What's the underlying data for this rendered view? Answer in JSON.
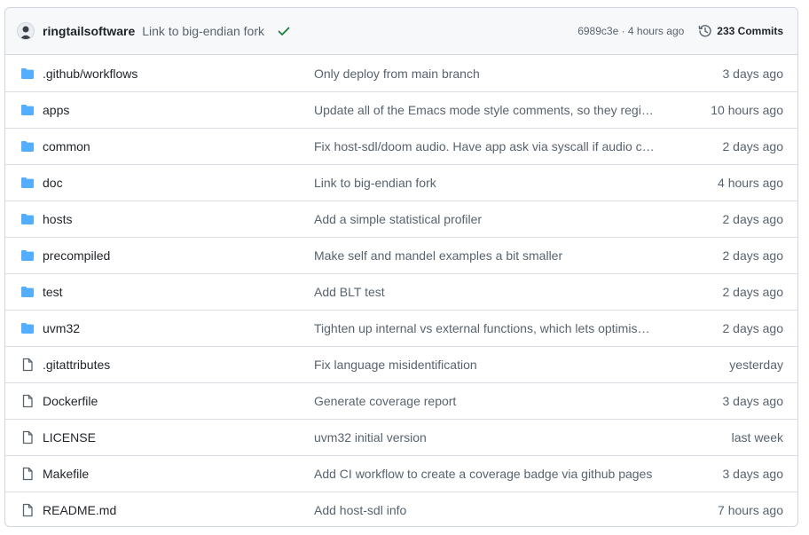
{
  "header": {
    "author": "ringtailsoftware",
    "commit_message": "Link to big-endian fork",
    "commit_hash_time": "6989c3e · 4 hours ago",
    "commits_count": "233 Commits",
    "status_color": "#1a7f37"
  },
  "colors": {
    "folder": "#54aeff",
    "file_icon": "#59636e"
  },
  "files": [
    {
      "type": "folder",
      "name": ".github/workflows",
      "message": "Only deploy from main branch",
      "age": "3 days ago"
    },
    {
      "type": "folder",
      "name": "apps",
      "message": "Update all of the Emacs mode style comments, so they register correctly",
      "age": "10 hours ago"
    },
    {
      "type": "folder",
      "name": "common",
      "message": "Fix host-sdl/doom audio. Have app ask via syscall if audio can be queued",
      "age": "2 days ago"
    },
    {
      "type": "folder",
      "name": "doc",
      "message": "Link to big-endian fork",
      "age": "4 hours ago"
    },
    {
      "type": "folder",
      "name": "hosts",
      "message": "Add a simple statistical profiler",
      "age": "2 days ago"
    },
    {
      "type": "folder",
      "name": "precompiled",
      "message": "Make self and mandel examples a bit smaller",
      "age": "2 days ago"
    },
    {
      "type": "folder",
      "name": "test",
      "message": "Add BLT test",
      "age": "2 days ago"
    },
    {
      "type": "folder",
      "name": "uvm32",
      "message": "Tighten up internal vs external functions, which lets optimiser do more",
      "age": "2 days ago"
    },
    {
      "type": "file",
      "name": ".gitattributes",
      "message": "Fix language misidentification",
      "age": "yesterday"
    },
    {
      "type": "file",
      "name": "Dockerfile",
      "message": "Generate coverage report",
      "age": "3 days ago"
    },
    {
      "type": "file",
      "name": "LICENSE",
      "message": "uvm32 initial version",
      "age": "last week"
    },
    {
      "type": "file",
      "name": "Makefile",
      "message": "Add CI workflow to create a coverage badge via github pages",
      "age": "3 days ago"
    },
    {
      "type": "file",
      "name": "README.md",
      "message": "Add host-sdl info",
      "age": "7 hours ago"
    }
  ]
}
